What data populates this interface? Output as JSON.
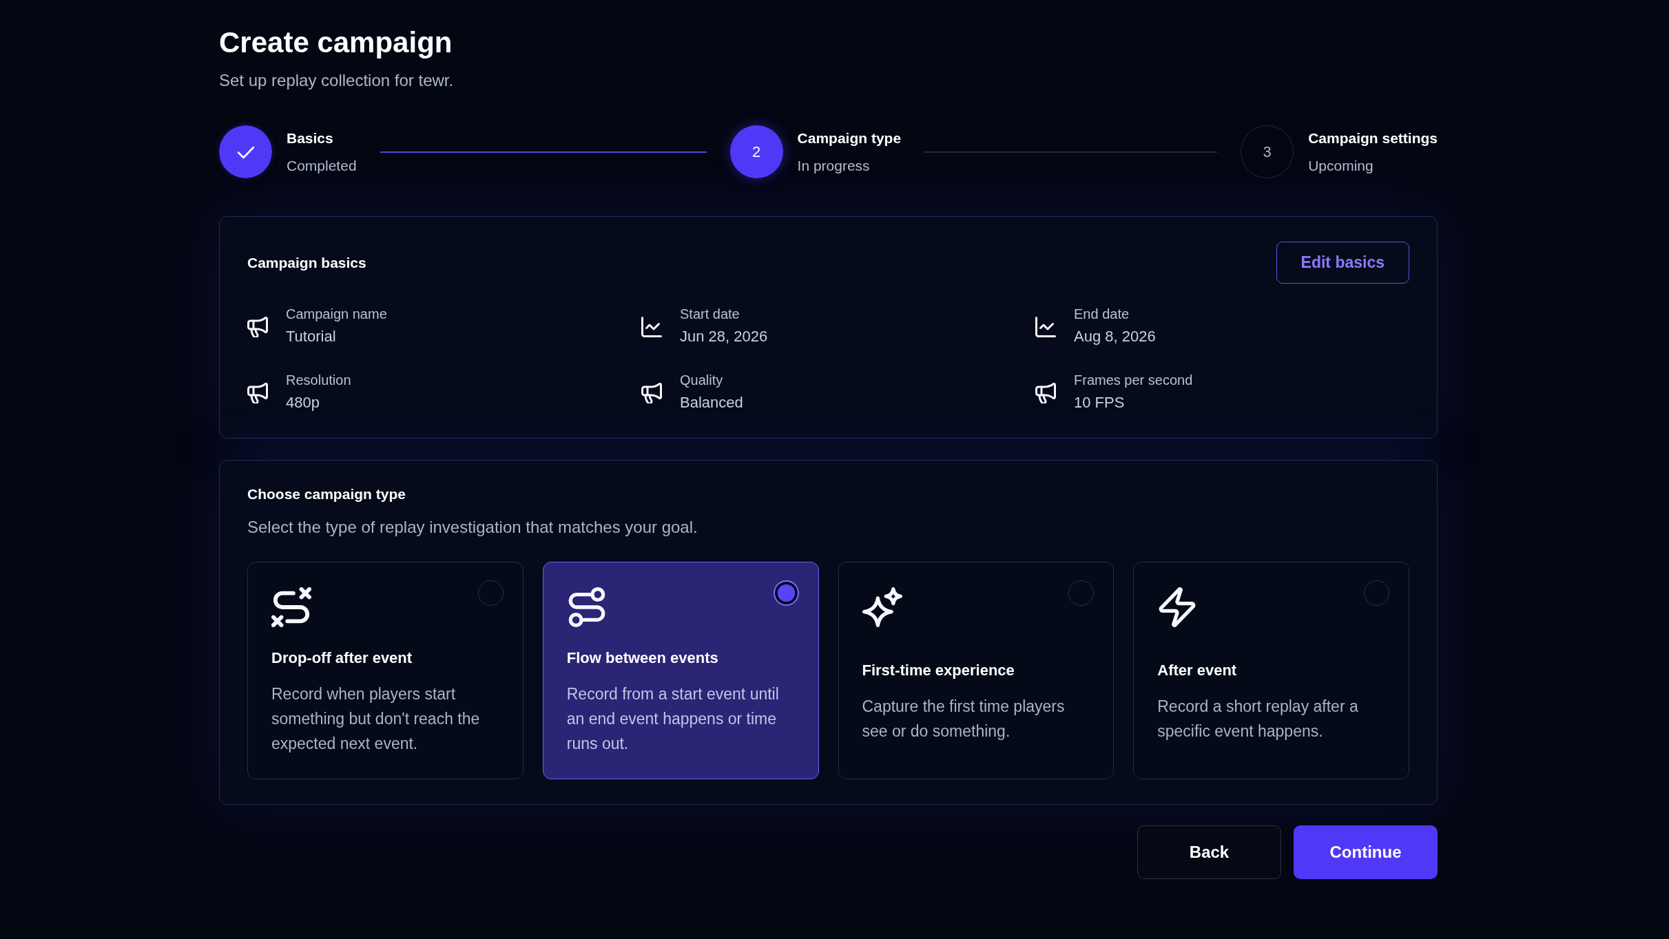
{
  "header": {
    "title": "Create campaign",
    "subtitle": "Set up replay collection for tewr."
  },
  "steps": [
    {
      "label": "Basics",
      "status": "Completed",
      "completed": true,
      "current": false
    },
    {
      "number": "2",
      "label": "Campaign type",
      "status": "In progress",
      "completed": false,
      "current": true
    },
    {
      "number": "3",
      "label": "Campaign settings",
      "status": "Upcoming",
      "completed": false,
      "current": false
    }
  ],
  "campaign_basics": {
    "title": "Campaign basics",
    "edit_button": "Edit basics",
    "fields": [
      {
        "kind": "detail",
        "label": "Campaign name",
        "value": "Tutorial"
      },
      {
        "kind": "date",
        "label": "Start date",
        "value": "Jun 28, 2026"
      },
      {
        "kind": "date",
        "label": "End date",
        "value": "Aug 8, 2026"
      },
      {
        "kind": "detail",
        "label": "Resolution",
        "value": "480p"
      },
      {
        "kind": "detail",
        "label": "Quality",
        "value": "Balanced"
      },
      {
        "kind": "detail",
        "label": "Frames per second",
        "value": "10 FPS"
      }
    ]
  },
  "campaign_type": {
    "title": "Choose campaign type",
    "description": "Select the type of replay investigation that matches your goal.",
    "options": [
      {
        "kind": "drop_off",
        "title": "Drop-off after event",
        "description": "Record when players start something but don't reach the expected next event.",
        "selected": false
      },
      {
        "kind": "flow",
        "title": "Flow between events",
        "description": "Record from a start event until an end event happens or time runs out.",
        "selected": true
      },
      {
        "kind": "first_time",
        "title": "First-time experience",
        "description": "Capture the first time players see or do something.",
        "selected": false
      },
      {
        "kind": "after_event",
        "title": "After event",
        "description": "Record a short replay after a specific event happens.",
        "selected": false
      }
    ]
  },
  "actions": [
    {
      "kind": "secondary",
      "label": "Back"
    },
    {
      "kind": "primary",
      "label": "Continue"
    }
  ]
}
